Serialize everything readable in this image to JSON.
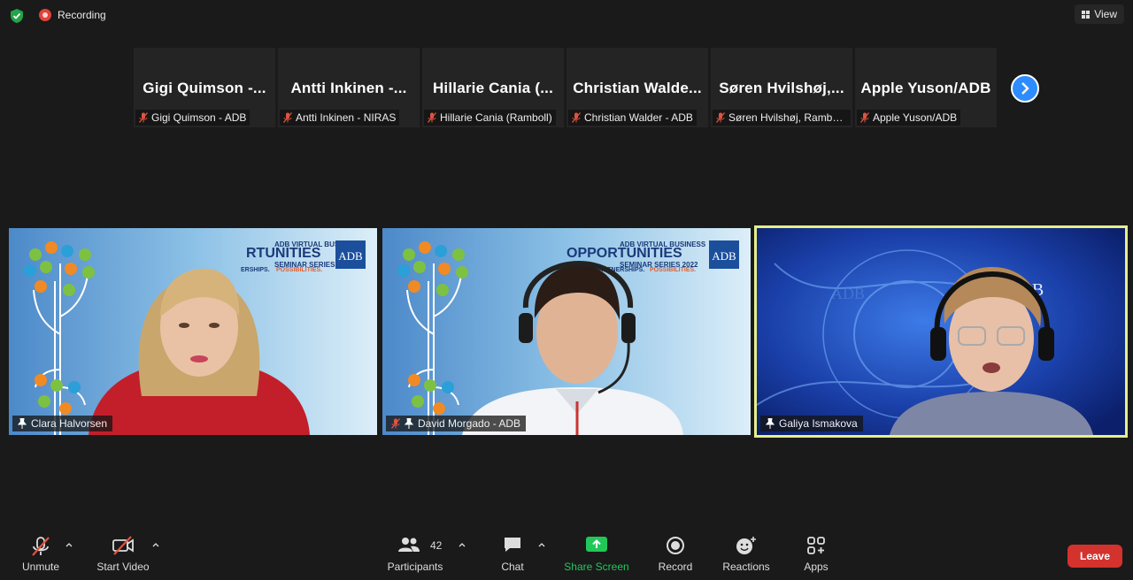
{
  "top": {
    "recording_label": "Recording",
    "view_label": "View"
  },
  "strip": {
    "tiles": [
      {
        "name": "Gigi Quimson -...",
        "label": "Gigi Quimson - ADB"
      },
      {
        "name": "Antti Inkinen -...",
        "label": "Antti Inkinen - NIRAS"
      },
      {
        "name": "Hillarie Cania (...",
        "label": "Hillarie Cania (Ramboll)"
      },
      {
        "name": "Christian Walde...",
        "label": "Christian Walder - ADB"
      },
      {
        "name": "Søren Hvilshøj,...",
        "label": "Søren Hvilshøj, Rambo..."
      },
      {
        "name": "Apple Yuson/ADB",
        "label": "Apple Yuson/ADB"
      }
    ]
  },
  "videos": [
    {
      "label": "Clara Halvorsen"
    },
    {
      "label": "David Morgado - ADB"
    },
    {
      "label": "Galiya Ismakova"
    }
  ],
  "banner": {
    "line1": "ADB VIRTUAL BUSINESS",
    "line2": "OPPORTUNITIES",
    "line2_cut": "RTUNITIES",
    "line3": "SEMINAR SERIES 2022",
    "line4a": "PARTNERSHIPS.",
    "line4a_cut": "ERSHIPS.",
    "line4b": "POSSIBILITIES.",
    "logo": "ADB"
  },
  "toolbar": {
    "unmute": "Unmute",
    "start_video": "Start Video",
    "participants": "Participants",
    "participants_count": "42",
    "chat": "Chat",
    "share_screen": "Share Screen",
    "record": "Record",
    "reactions": "Reactions",
    "apps": "Apps",
    "leave": "Leave"
  },
  "colors": {
    "share_green": "#22c75a",
    "leave_red": "#d3322d",
    "active_border": "#e5ef8a",
    "next_blue": "#2d8cff"
  }
}
